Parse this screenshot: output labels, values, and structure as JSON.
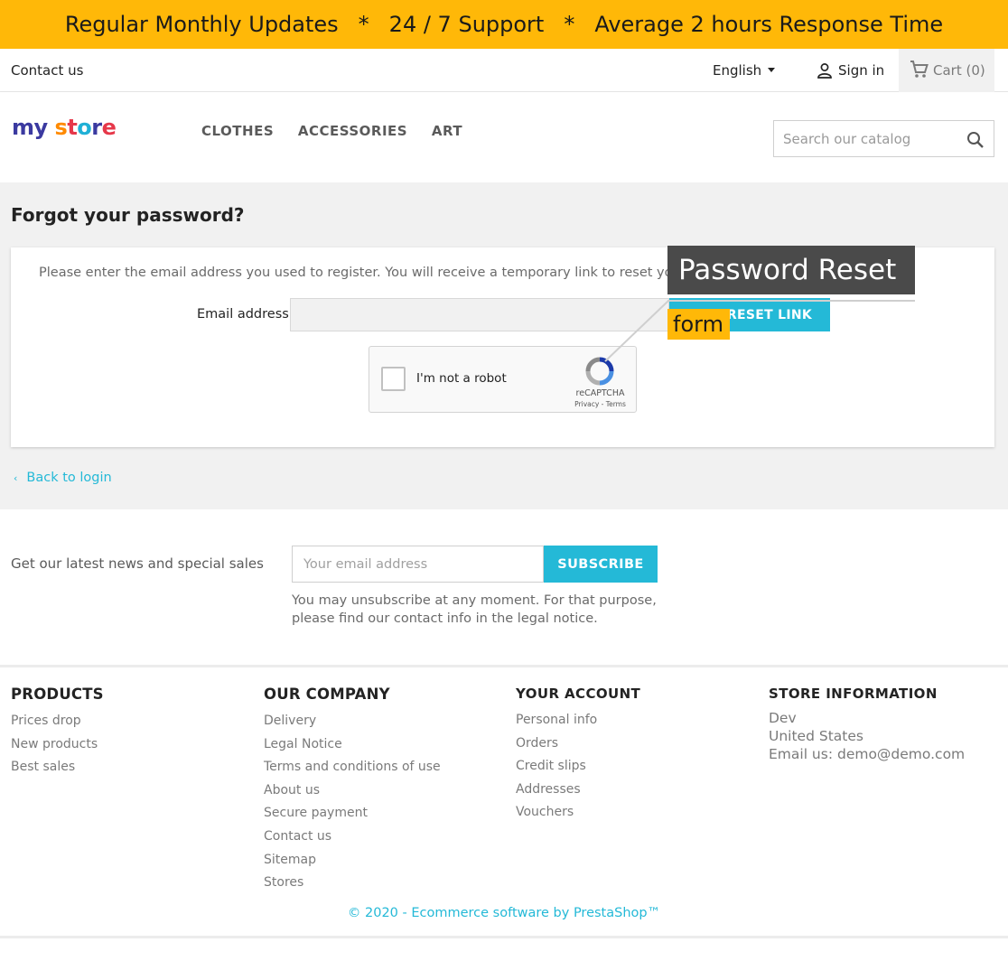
{
  "promo": {
    "part1": "Regular Monthly Updates",
    "sep": "*",
    "part2": "24 / 7 Support",
    "part3": "Average 2 hours Response Time"
  },
  "topnav": {
    "contact": "Contact us",
    "language": "English",
    "signin": "Sign in",
    "cart": "Cart (0)"
  },
  "header": {
    "logo": {
      "l1": "my",
      "s": "s",
      "t": "t",
      "o": "o",
      "r": "r",
      "e": "e"
    },
    "menu": [
      "CLOTHES",
      "ACCESSORIES",
      "ART"
    ],
    "search_placeholder": "Search our catalog"
  },
  "main": {
    "title": "Forgot your password?",
    "instructions": "Please enter the email address you used to register. You will receive a temporary link to reset your pa",
    "email_label": "Email address",
    "reset_button": "RESET LINK",
    "captcha": {
      "label": "I'm not a robot",
      "brand": "reCAPTCHA",
      "terms": "Privacy - Terms"
    },
    "back": "Back to login"
  },
  "annotation": {
    "title": "Password Reset",
    "tag": "form",
    "colors": {
      "title_bg": "#4a4a4a",
      "tag_bg": "#ffb808"
    }
  },
  "newsletter": {
    "text": "Get our latest news and special sales",
    "placeholder": "Your email address",
    "button": "SUBSCRIBE",
    "note": "You may unsubscribe at any moment. For that purpose, please find our contact info in the legal notice."
  },
  "footer": {
    "products": {
      "title": "PRODUCTS",
      "items": [
        "Prices drop",
        "New products",
        "Best sales"
      ]
    },
    "company": {
      "title": "OUR COMPANY",
      "items": [
        "Delivery",
        "Legal Notice",
        "Terms and conditions of use",
        "About us",
        "Secure payment",
        "Contact us",
        "Sitemap",
        "Stores"
      ]
    },
    "account": {
      "title": "YOUR ACCOUNT",
      "items": [
        "Personal info",
        "Orders",
        "Credit slips",
        "Addresses",
        "Vouchers"
      ]
    },
    "store": {
      "title": "STORE INFORMATION",
      "items": [
        "Dev",
        "United States",
        "Email us: demo@demo.com"
      ]
    },
    "copyright": "© 2020 - Ecommerce software by PrestaShop™"
  },
  "colors": {
    "accent": "#24b9d7",
    "promo_bg": "#ffb808",
    "page_bg": "#f1f1f1"
  },
  "icons": {
    "user": "user-icon",
    "cart": "cart-icon",
    "search": "search-icon",
    "caret": "caret-down-icon",
    "chevron": "chevron-left-icon",
    "recaptcha": "recaptcha-logo-icon"
  }
}
